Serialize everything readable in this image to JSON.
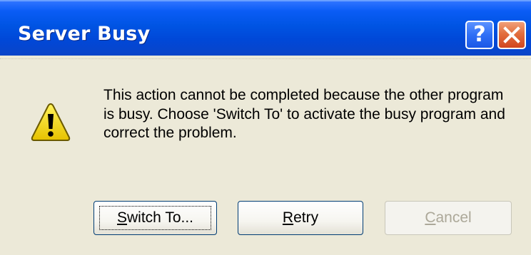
{
  "window": {
    "title": "Server Busy"
  },
  "titlebar_buttons": {
    "help_label": "?",
    "close_icon": "close-icon"
  },
  "message": {
    "text": "This action cannot be completed because the other program is busy. Choose 'Switch To' to activate the busy program and correct the problem."
  },
  "icon": {
    "name": "warning-icon",
    "color": "#f5e020"
  },
  "buttons": {
    "switch_to": {
      "accel": "S",
      "rest": "witch To...",
      "focused": true,
      "enabled": true
    },
    "retry": {
      "accel": "R",
      "rest": "etry",
      "enabled": true
    },
    "cancel": {
      "accel": "C",
      "rest": "ancel",
      "enabled": false
    }
  },
  "colors": {
    "titlebar": "#0054e3",
    "client": "#ece9d8",
    "close_button": "#d2461f",
    "help_button": "#2f6ff6"
  }
}
